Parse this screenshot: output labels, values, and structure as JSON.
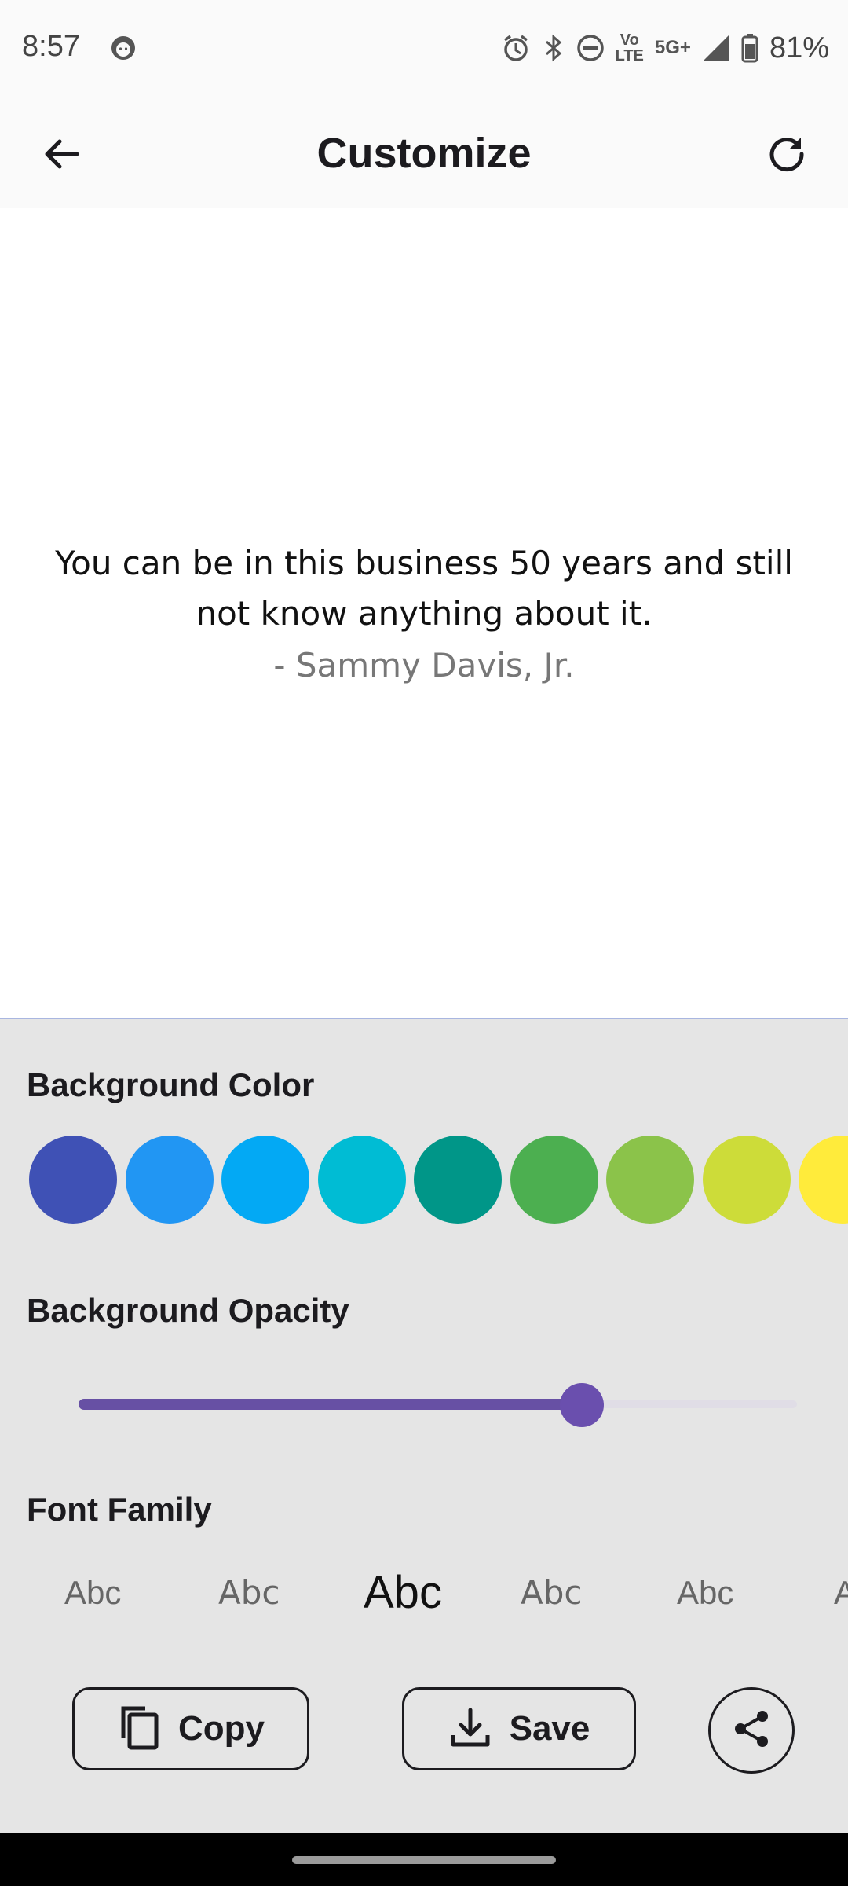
{
  "status_bar": {
    "time": "8:57",
    "network_label_top": "Vo",
    "network_label_bottom": "LTE",
    "signal_label": "5G+",
    "battery": "81%"
  },
  "app_bar": {
    "title": "Customize",
    "back_icon": "arrow-left-icon",
    "refresh_icon": "refresh-icon"
  },
  "preview": {
    "quote": "You can be in this business 50 years and still not know anything about it.",
    "author": "- Sammy Davis, Jr.",
    "background_color": "#ffffff"
  },
  "background_color": {
    "label": "Background Color",
    "swatches": [
      "#3f51b5",
      "#2196f3",
      "#03a9f4",
      "#00bcd4",
      "#009688",
      "#4caf50",
      "#8bc34a",
      "#cddc39",
      "#ffeb3b"
    ]
  },
  "background_opacity": {
    "label": "Background Opacity",
    "value_fraction": 0.7,
    "accent_color": "#6750a4"
  },
  "font_family": {
    "label": "Font Family",
    "options": [
      "Abc",
      "Abc",
      "Abc",
      "Abc",
      "Abc",
      "A"
    ],
    "selected_index": 2
  },
  "actions": {
    "copy_label": "Copy",
    "save_label": "Save",
    "share_icon": "share-icon"
  }
}
